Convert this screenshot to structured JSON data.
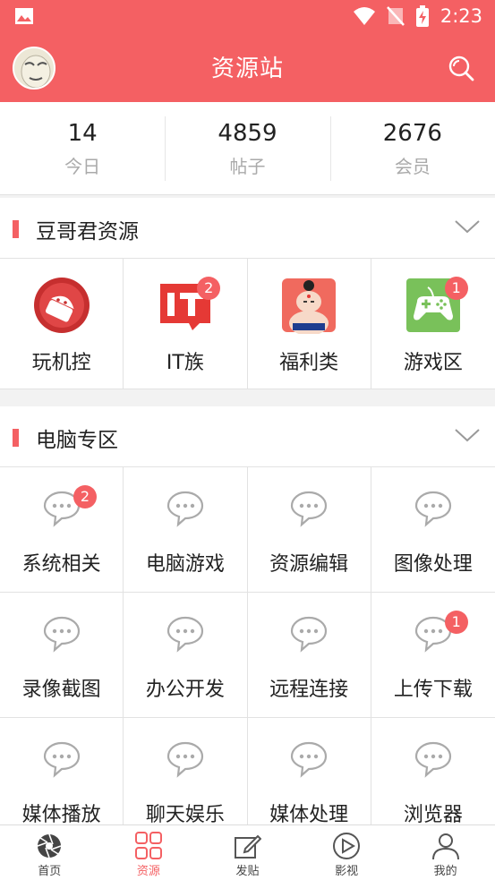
{
  "status_bar": {
    "time": "2:23",
    "icons": [
      "image-icon",
      "wifi-icon",
      "no-signal-icon",
      "battery-charging-icon"
    ]
  },
  "app_bar": {
    "title": "资源站",
    "avatar_icon": "avatar-image",
    "search_icon": "search-icon"
  },
  "stats": [
    {
      "value": "14",
      "label": "今日"
    },
    {
      "value": "4859",
      "label": "帖子"
    },
    {
      "value": "2676",
      "label": "会员"
    }
  ],
  "section1": {
    "title": "豆哥君资源",
    "items": [
      {
        "label": "玩机控",
        "icon": "android-icon",
        "badge": ""
      },
      {
        "label": "IT族",
        "icon": "it-logo-icon",
        "badge": "2"
      },
      {
        "label": "福利类",
        "icon": "sumo-icon",
        "badge": ""
      },
      {
        "label": "游戏区",
        "icon": "gamepad-icon",
        "badge": "1"
      }
    ]
  },
  "section2": {
    "title": "电脑专区",
    "items": [
      {
        "label": "系统相关",
        "badge": "2"
      },
      {
        "label": "电脑游戏",
        "badge": ""
      },
      {
        "label": "资源编辑",
        "badge": ""
      },
      {
        "label": "图像处理",
        "badge": ""
      },
      {
        "label": "录像截图",
        "badge": ""
      },
      {
        "label": "办公开发",
        "badge": ""
      },
      {
        "label": "远程连接",
        "badge": ""
      },
      {
        "label": "上传下载",
        "badge": "1"
      },
      {
        "label": "媒体播放",
        "badge": ""
      },
      {
        "label": "聊天娱乐",
        "badge": ""
      },
      {
        "label": "媒体处理",
        "badge": ""
      },
      {
        "label": "浏览器",
        "badge": ""
      }
    ]
  },
  "bottom_nav": [
    {
      "label": "首页",
      "icon": "aperture-icon",
      "active": false
    },
    {
      "label": "资源",
      "icon": "grid-icon",
      "active": true
    },
    {
      "label": "发贴",
      "icon": "edit-icon",
      "active": false
    },
    {
      "label": "影视",
      "icon": "play-icon",
      "active": false
    },
    {
      "label": "我的",
      "icon": "user-icon",
      "active": false
    }
  ],
  "colors": {
    "accent": "#f46063",
    "badge": "#f46063",
    "text": "#222222",
    "muted": "#aaaaaa"
  }
}
